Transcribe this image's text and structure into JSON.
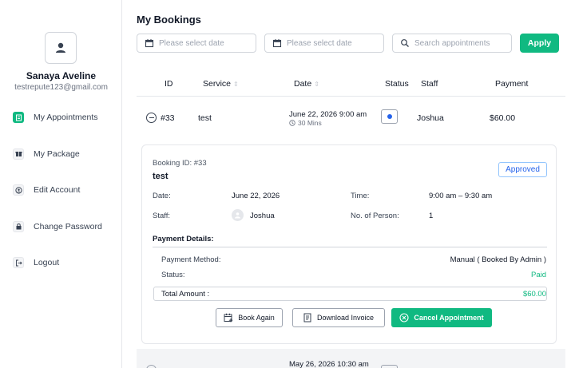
{
  "sidebar": {
    "user_name": "Sanaya Aveline",
    "user_email": "testrepute123@gmail.com",
    "items": [
      {
        "label": "My Appointments",
        "icon": "clipboard-icon",
        "active": true
      },
      {
        "label": "My Package",
        "icon": "gift-icon",
        "active": false
      },
      {
        "label": "Edit Account",
        "icon": "user-card-icon",
        "active": false
      },
      {
        "label": "Change Password",
        "icon": "lock-icon",
        "active": false
      },
      {
        "label": "Logout",
        "icon": "logout-icon",
        "active": false
      }
    ]
  },
  "page": {
    "title": "My Bookings"
  },
  "filters": {
    "start_date_placeholder": "Please select date",
    "end_date_placeholder": "Please select date",
    "search_placeholder": "Search appointments",
    "apply_label": "Apply"
  },
  "table": {
    "headers": {
      "id": "ID",
      "service": "Service",
      "date": "Date",
      "status": "Status",
      "staff": "Staff",
      "payment": "Payment"
    },
    "rows": [
      {
        "id": "#33",
        "service": "test",
        "date": "June 22, 2026 9:00 am",
        "duration": "30 Mins",
        "staff": "Joshua",
        "payment": "$60.00"
      },
      {
        "date": "May 26, 2026 10:30 am"
      }
    ]
  },
  "details": {
    "booking_id": "Booking ID: #33",
    "service": "test",
    "status_badge": "Approved",
    "date_label": "Date:",
    "date_value": "June 22, 2026",
    "time_label": "Time:",
    "time_value": "9:00 am – 9:30 am",
    "staff_label": "Staff:",
    "staff_value": "Joshua",
    "persons_label": "No. of Person:",
    "persons_value": "1",
    "payment_title": "Payment Details:",
    "method_label": "Payment Method:",
    "method_value": "Manual ( Booked By Admin )",
    "status_label": "Status:",
    "status_value": "Paid",
    "total_label": "Total Amount :",
    "total_value": "$60.00",
    "book_again": "Book Again",
    "download_invoice": "Download Invoice",
    "cancel_appointment": "Cancel Appointment"
  },
  "colors": {
    "accent": "#10b981",
    "badge": "#2563eb"
  }
}
